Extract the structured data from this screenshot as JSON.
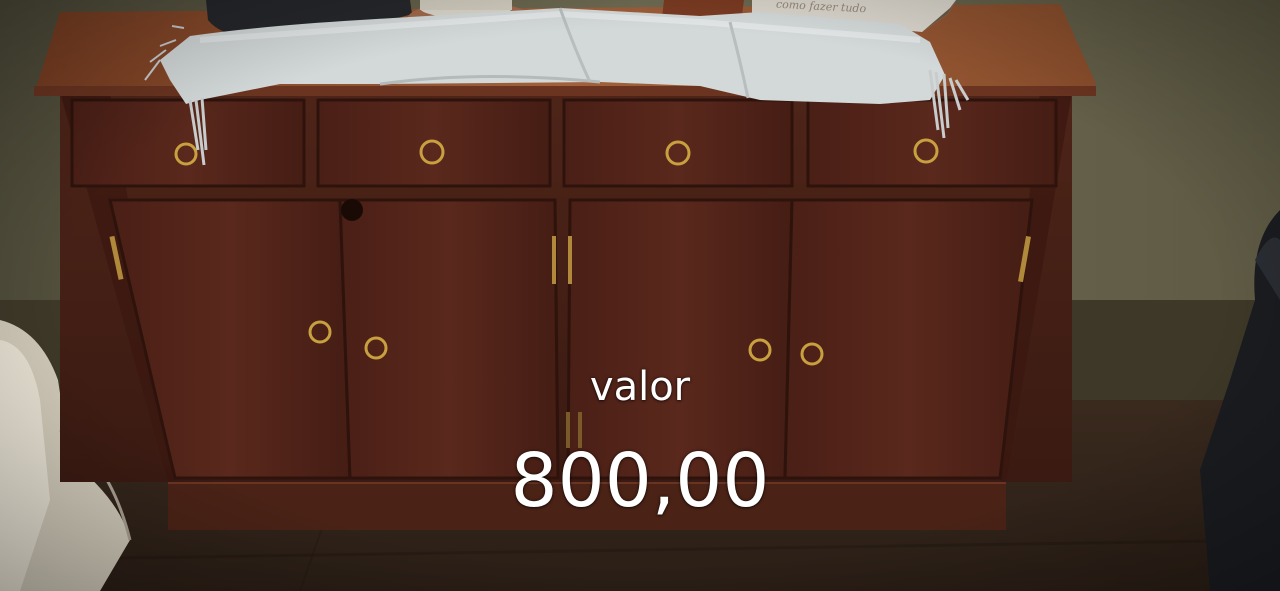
{
  "caption": {
    "label": "valor",
    "price": "800,00",
    "text_color": "#ffffff"
  },
  "book": {
    "title": "como fazer tudo"
  },
  "scene": {
    "subject": "wooden sideboard cabinet",
    "drawers": 4,
    "doors": 4,
    "wood_color": "#4a2218",
    "top_color": "#8a4a2a",
    "wall_color": "#6e6a52",
    "cloth_color": "#d8dcdc",
    "handle_color": "#c8a040"
  }
}
